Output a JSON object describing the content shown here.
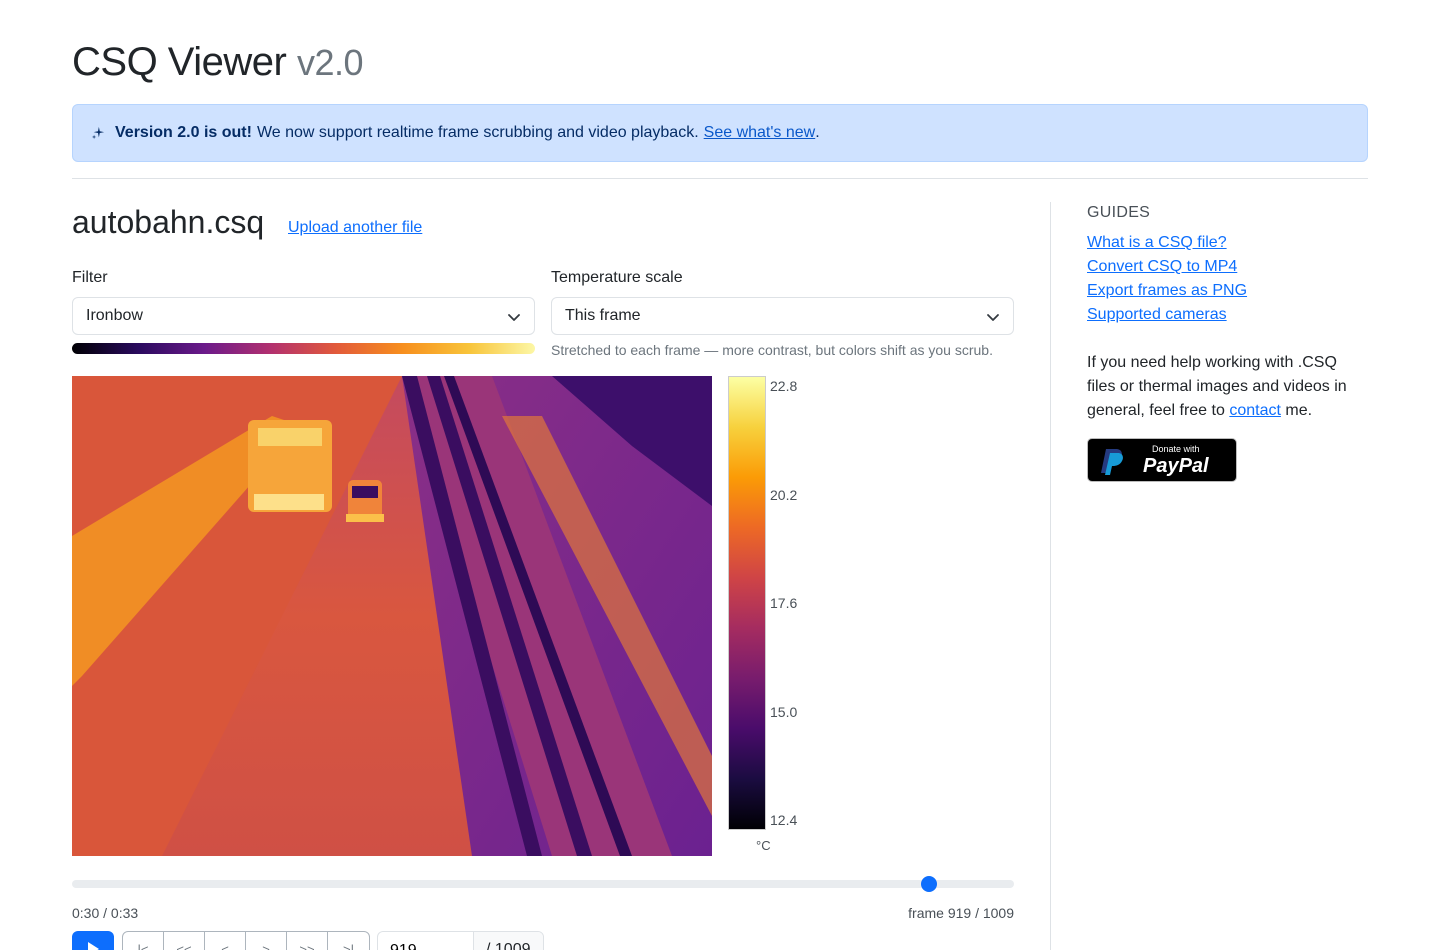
{
  "header": {
    "title": "CSQ Viewer",
    "version": "v2.0"
  },
  "alert": {
    "bold": "Version 2.0 is out!",
    "text": "We now support realtime frame scrubbing and video playback.",
    "link": "See what's new",
    "end": "."
  },
  "file": {
    "name": "autobahn.csq",
    "upload_link": "Upload another file"
  },
  "filter": {
    "label": "Filter",
    "selected": "Ironbow"
  },
  "temperature_scale": {
    "label": "Temperature scale",
    "selected": "This frame",
    "hint": "Stretched to each frame — more contrast, but colors shift as you scrub."
  },
  "colorbar": {
    "ticks": [
      "22.8",
      "20.2",
      "17.6",
      "15.0",
      "12.4"
    ],
    "unit": "°C"
  },
  "playback": {
    "time": "0:30 / 0:33",
    "frame_info": "frame 919 / 1009",
    "current_frame": 919,
    "total_frames": 1009,
    "progress": 0.9098,
    "frame_input_value": "919",
    "frame_total_label": "/ 1009"
  },
  "controls": {
    "buttons": [
      "first-frame",
      "back-10",
      "back-1",
      "forward-1",
      "forward-10",
      "last-frame"
    ],
    "glyphs": [
      "|<",
      "<<",
      "<",
      ">",
      ">>",
      ">|"
    ]
  },
  "sidebar": {
    "title": "GUIDES",
    "guides": [
      "What is a CSQ file?",
      "Convert CSQ to MP4",
      "Export frames as PNG",
      "Supported cameras"
    ],
    "help_before": "If you need help working with .CSQ files or thermal images and videos in general, feel free to",
    "help_link": "contact",
    "help_after": "me.",
    "paypal_small": "Donate with",
    "paypal_big": "PayPal"
  },
  "colors": {
    "primary": "#0d6efd",
    "alert_bg": "#cfe2ff"
  }
}
